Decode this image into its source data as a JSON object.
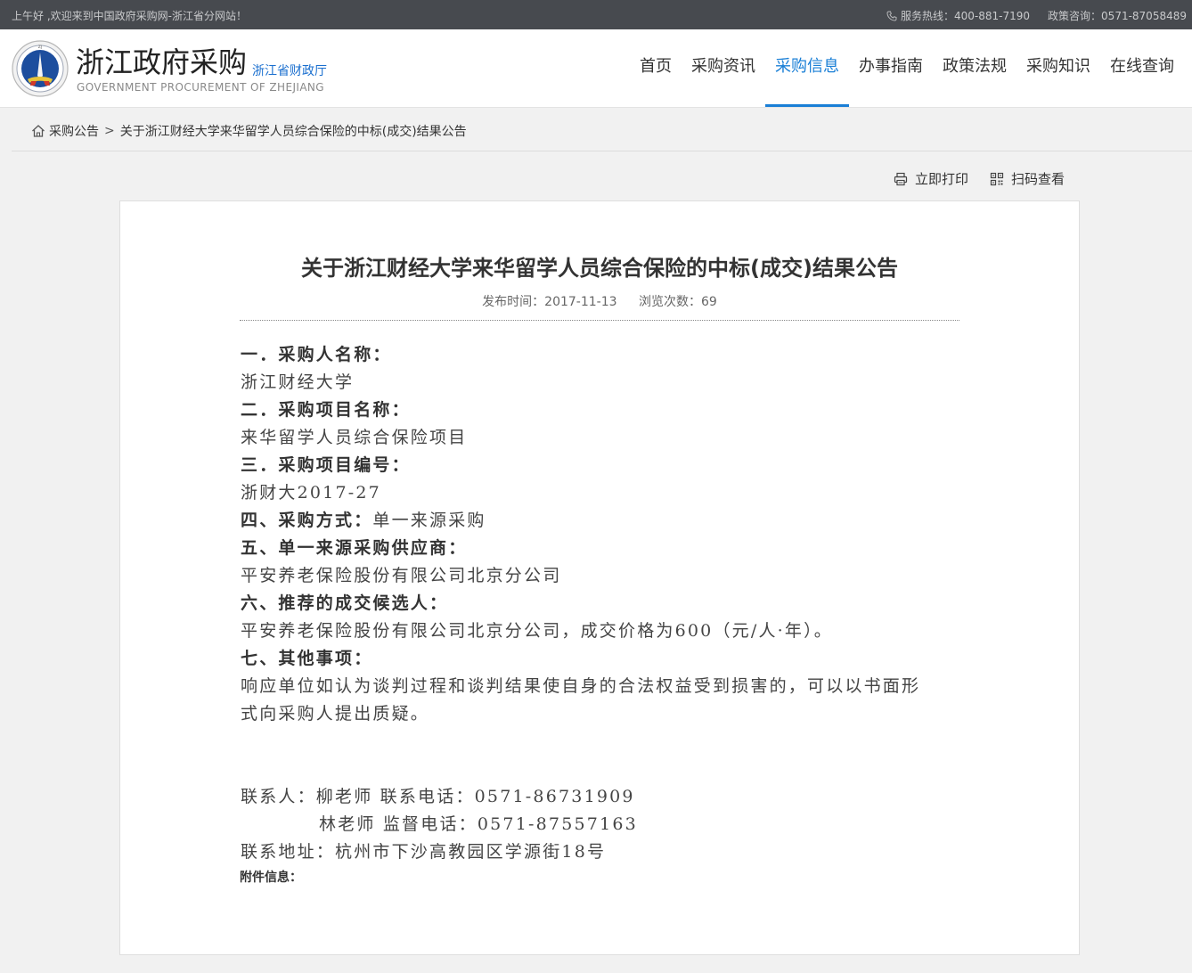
{
  "topbar": {
    "greeting": "上午好 ,欢迎来到中国政府采购网-浙江省分网站！",
    "hotline": "服务热线：400-881-7190",
    "consult": "政策咨询：0571-87058489"
  },
  "header": {
    "title": "浙江政府采购",
    "subtitle": "浙江省财政厅",
    "english": "GOVERNMENT PROCUREMENT OF ZHEJIANG",
    "nav": [
      {
        "label": "首页"
      },
      {
        "label": "采购资讯"
      },
      {
        "label": "采购信息"
      },
      {
        "label": "办事指南"
      },
      {
        "label": "政策法规"
      },
      {
        "label": "采购知识"
      },
      {
        "label": "在线查询"
      }
    ],
    "active_nav": "采购信息",
    "accent": "#1a7fd6"
  },
  "breadcrumb": {
    "section": "采购公告",
    "separator": ">",
    "current": "关于浙江财经大学来华留学人员综合保险的中标(成交)结果公告"
  },
  "tools": {
    "print": "立即打印",
    "scan": "扫码查看"
  },
  "article": {
    "title": "关于浙江财经大学来华留学人员综合保险的中标(成交)结果公告",
    "publish_time": "发布时间：2017-11-13",
    "views": "浏览次数：69",
    "h1": "一．采购人名称：",
    "v1": "浙江财经大学",
    "h2": "二．采购项目名称：",
    "v2": "来华留学人员综合保险项目",
    "h3": "三．采购项目编号：",
    "v3": "浙财大2017-27",
    "h4": "四、采购方式：",
    "v4": "单一来源采购",
    "h5": "五、单一来源采购供应商：",
    "v5": "平安养老保险股份有限公司北京分公司",
    "h6": "六、推荐的成交候选人：",
    "v6": "平安养老保险股份有限公司北京分公司，成交价格为600（元/人·年）。",
    "h7": "七、其他事项：",
    "v7a": "响应单位如认为谈判过程和谈判结果使自身的合法权益受到损害的，可以以书面形",
    "v7b": "式向采购人提出质疑。",
    "contact1": "联系人：柳老师  联系电话：0571-86731909",
    "contact2": "林老师  监督电话：0571-87557163",
    "address": "联系地址：杭州市下沙高教园区学源街18号",
    "attachment_label": "附件信息："
  }
}
